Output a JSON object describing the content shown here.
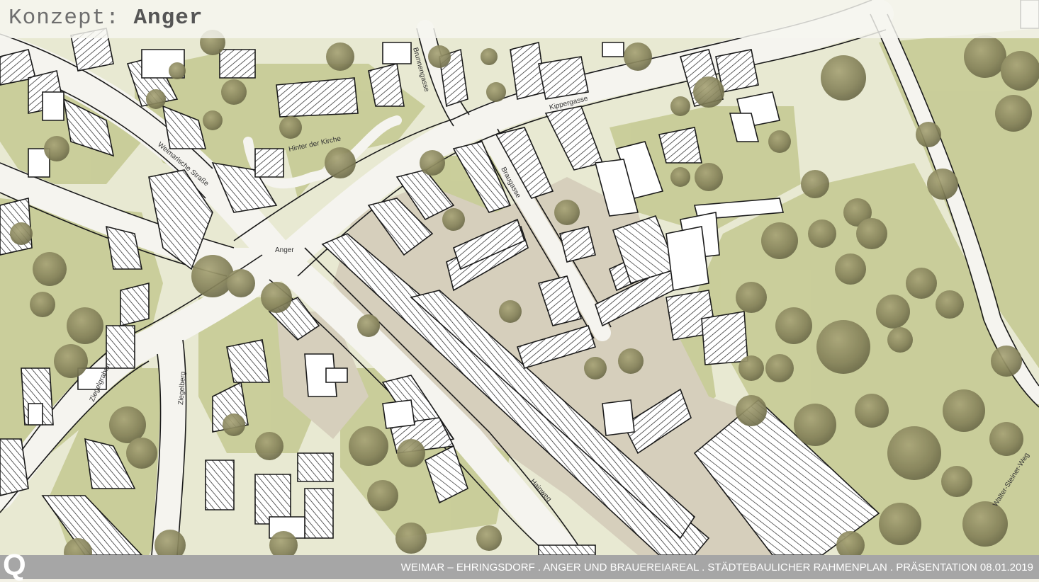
{
  "header": {
    "title_prefix": "Konzept:",
    "title_main": "Anger"
  },
  "map": {
    "street_labels": {
      "weimarische_strasse": "Weimarische Straße",
      "hinter_der_kirche": "Hinter der Kirche",
      "brunnengasse": "Brunnengasse",
      "kippergasse": "Kippergasse",
      "brauagasse": "Braugasse",
      "anger": "Anger",
      "ziegelgraben": "Ziegelgraben",
      "ziegelberg": "Ziegelberg",
      "hainweg": "Hainweg",
      "walter_steiner_weg": "Walter-Steiner-Weg"
    },
    "colors": {
      "green_area": "#c7cc97",
      "light_area": "#e7e8cf",
      "plaza": "#d7d0bd",
      "street": "#f4f3ee",
      "tree": "#8d8a5c",
      "building_line": "#1a1a1a"
    }
  },
  "footer": {
    "text": "WEIMAR – EHRINGSDORF . ANGER UND BRAUEREIAREAL . STÄDTEBAULICHER RAHMENPLAN . PRÄSENTATION 08.01.2019",
    "corner_mark": "Q"
  }
}
